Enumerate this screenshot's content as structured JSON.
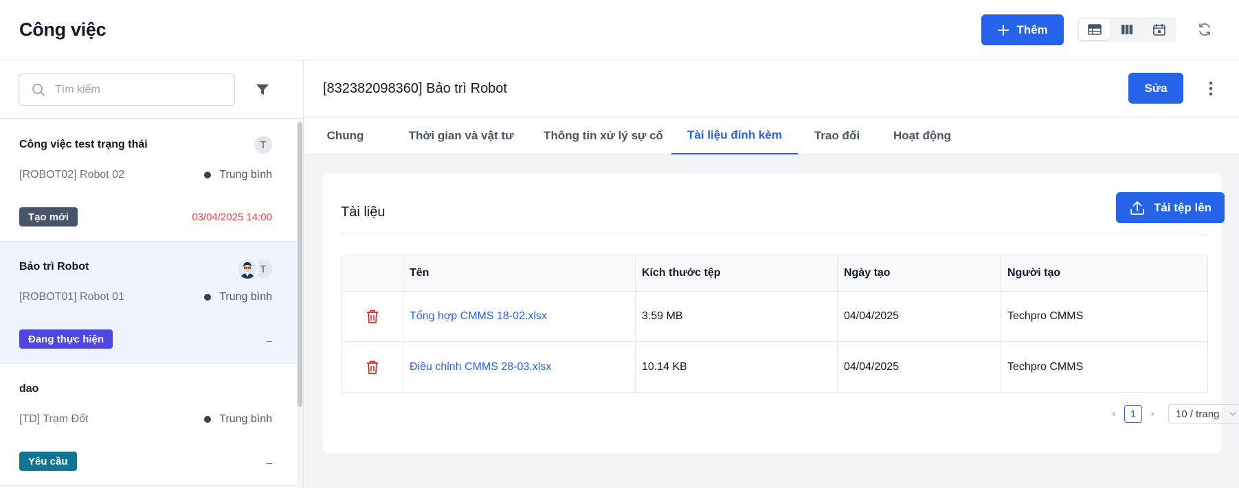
{
  "app": {
    "title": "Công việc"
  },
  "toolbar": {
    "add_label": "Thêm",
    "views": [
      "table-view-icon",
      "board-view-icon",
      "calendar-view-icon"
    ],
    "active_view": "table-view-icon",
    "accent": "#2563eb"
  },
  "search": {
    "placeholder": "Tìm kiếm",
    "value": ""
  },
  "tasks": [
    {
      "title": "Công việc test trạng thái",
      "asset": "[ROBOT02] Robot 02",
      "priority": "Trung bình",
      "status": "Tạo mới",
      "status_color": "#475569",
      "due": "03/04/2025 14:00",
      "avatar": "T"
    },
    {
      "title": "Bảo trì Robot",
      "asset": "[ROBOT01] Robot 01",
      "priority": "Trung bình",
      "status": "Đang thực hiện",
      "status_color": "#4f46e5",
      "due": "_",
      "avatar": "T"
    },
    {
      "title": "dao",
      "asset": "[TD] Trạm Đốt",
      "priority": "Trung bình",
      "status": "Yêu cầu",
      "status_color": "#0e7490",
      "due": "_",
      "avatar": ""
    }
  ],
  "detail": {
    "title": "[832382098360] Bảo trì Robot",
    "edit_label": "Sửa",
    "tabs": [
      "Chung",
      "Thời gian và vật tư",
      "Thông tin xử lý sự cố",
      "Tài liệu đính kèm",
      "Trao đổi",
      "Hoạt động"
    ],
    "active_tab": "Tài liệu đính kèm"
  },
  "documents": {
    "title": "Tài liệu",
    "upload_label": "Tải tệp lên",
    "columns": [
      "",
      "Tên",
      "Kích thước tệp",
      "Ngày tạo",
      "Người tạo"
    ],
    "rows": [
      {
        "name": "Tổng hợp CMMS 18-02.xlsx",
        "size": "3.59 MB",
        "created": "04/04/2025",
        "creator": "Techpro CMMS"
      },
      {
        "name": "Điều chỉnh CMMS 28-03.xlsx",
        "size": "10.14 KB",
        "created": "04/04/2025",
        "creator": "Techpro CMMS"
      }
    ],
    "pagination": {
      "page": "1",
      "page_size": "10 / trang"
    }
  }
}
